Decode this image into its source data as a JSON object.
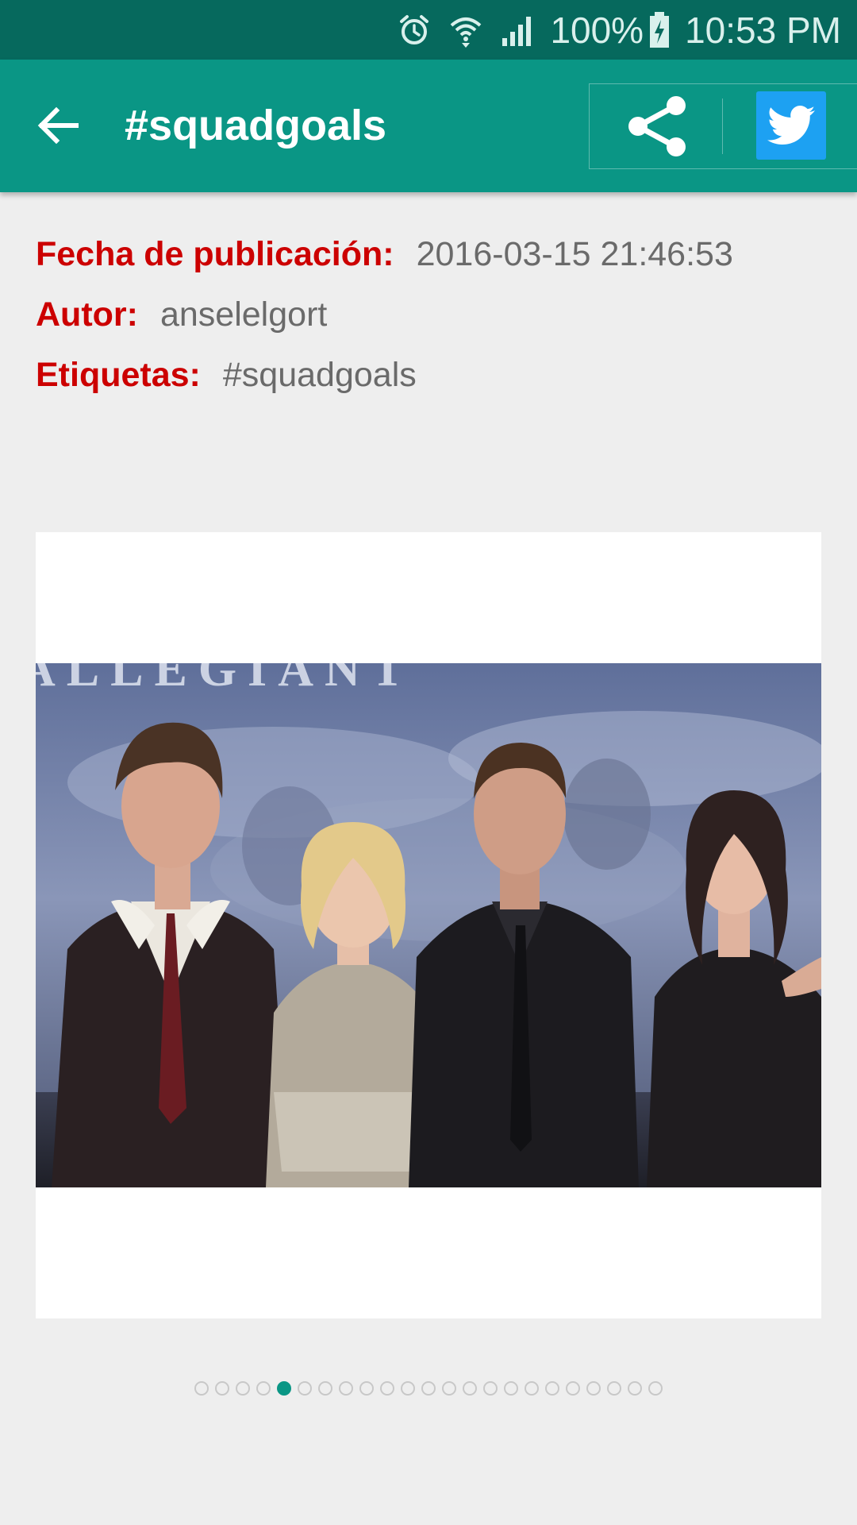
{
  "status_bar": {
    "battery": "100%",
    "time": "10:53 PM",
    "icons": [
      "alarm-icon",
      "wifi-icon",
      "cell-signal-icon",
      "battery-charging-icon"
    ]
  },
  "app_bar": {
    "title": "#squadgoals",
    "background": "#0a9685",
    "icons": [
      "back-arrow-icon",
      "share-icon",
      "twitter-icon"
    ]
  },
  "meta": {
    "date_label": "Fecha de publicación:",
    "date_value": "2016-03-15 21:46:53",
    "author_label": "Autor:",
    "author_value": "anselelgort",
    "tags_label": "Etiquetas:",
    "tags_value": "#squadgoals",
    "label_color": "#cc0000"
  },
  "photo": {
    "banner_text": "ALLEGIANT",
    "people_count": 4
  },
  "pager": {
    "total": 23,
    "active_index": 4,
    "active_color": "#0a9685"
  }
}
